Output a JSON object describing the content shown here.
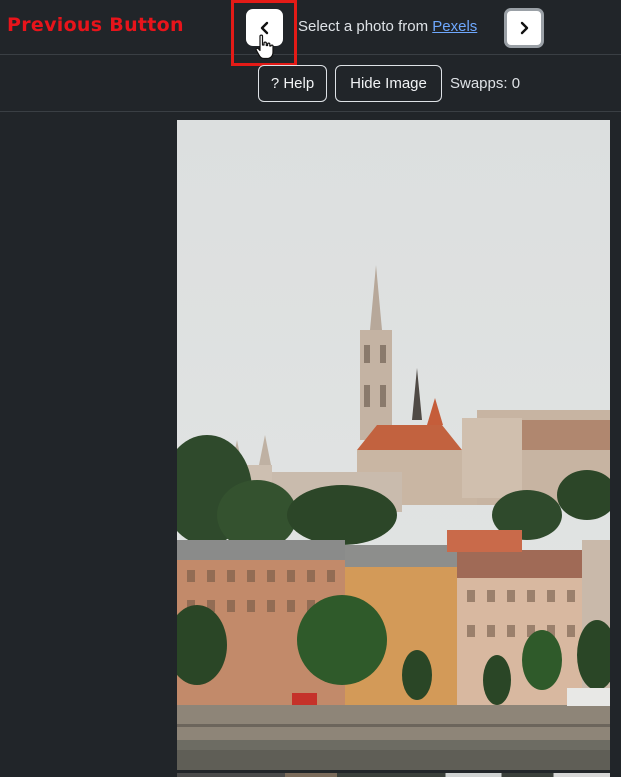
{
  "annotation": {
    "label": "Previous Button",
    "color": "#e8141b"
  },
  "nav": {
    "prev_icon": "chevron-left-icon",
    "next_icon": "chevron-right-icon",
    "select_prefix": "Select a photo from ",
    "select_link": "Pexels"
  },
  "toolbar": {
    "help_label": "? Help",
    "hide_label": "Hide Image",
    "swapps_text": "Swapps: 0"
  },
  "photo": {
    "subject": "church-skyline-photo"
  },
  "colors": {
    "background": "#212529",
    "link": "#6ea8fe",
    "button_bg": "#ffffff"
  }
}
